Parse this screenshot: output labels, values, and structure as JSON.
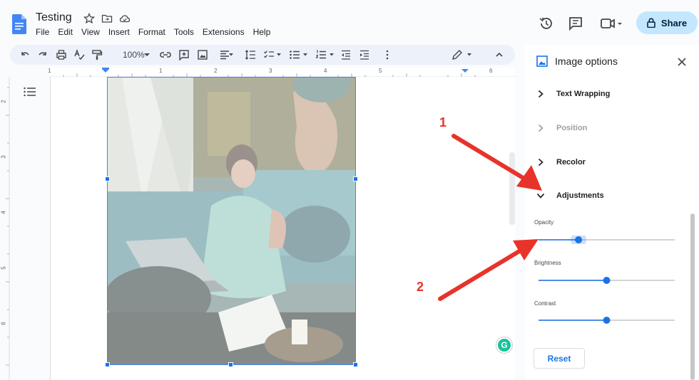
{
  "doc": {
    "title": "Testing",
    "menu": [
      "File",
      "Edit",
      "View",
      "Insert",
      "Format",
      "Tools",
      "Extensions",
      "Help"
    ]
  },
  "header": {
    "share_label": "Share"
  },
  "toolbar": {
    "zoom": "100%"
  },
  "ruler": {
    "top_marks": [
      "1",
      "1",
      "2",
      "3",
      "4",
      "5",
      "6"
    ],
    "side_marks": [
      "2",
      "3",
      "4",
      "5",
      "6"
    ]
  },
  "panel": {
    "title": "Image options",
    "sections": [
      {
        "label": "Text Wrapping",
        "expanded": false,
        "disabled": false
      },
      {
        "label": "Position",
        "expanded": false,
        "disabled": true
      },
      {
        "label": "Recolor",
        "expanded": false,
        "disabled": false
      },
      {
        "label": "Adjustments",
        "expanded": true,
        "disabled": false
      }
    ],
    "adjustments": {
      "opacity": {
        "label": "Opacity",
        "value": 0.28
      },
      "brightness": {
        "label": "Brightness",
        "value": 0.5
      },
      "contrast": {
        "label": "Contrast",
        "value": 0.5
      }
    },
    "reset_label": "Reset"
  },
  "annotations": [
    "1",
    "2"
  ],
  "colors": {
    "accent": "#1a73e8",
    "share_bg": "#c2e7ff",
    "arrow": "#e8332a"
  }
}
